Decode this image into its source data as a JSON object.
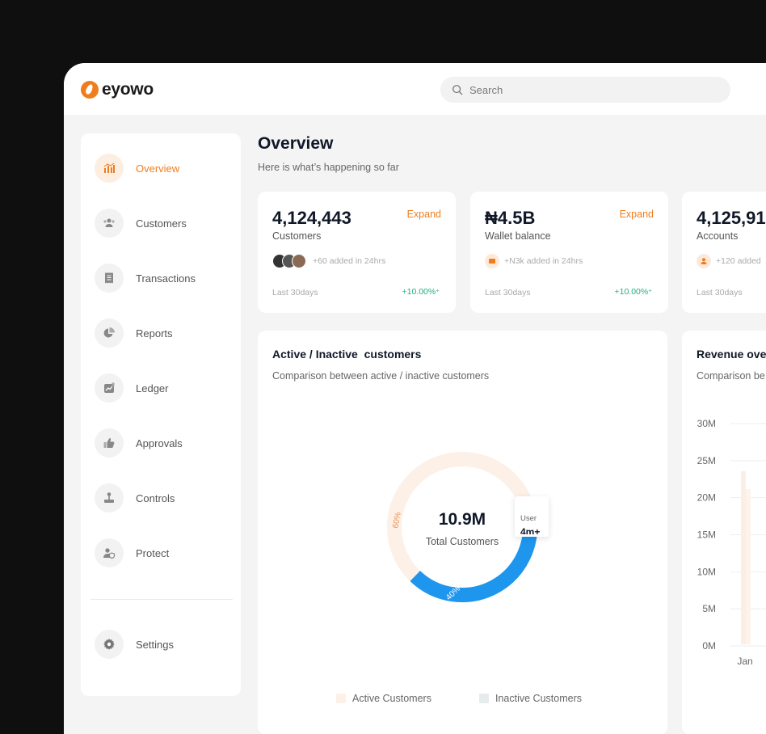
{
  "app": {
    "brand": "eyowo"
  },
  "search": {
    "placeholder": "Search"
  },
  "sidebar": {
    "items": [
      {
        "label": "Overview",
        "icon": "chart-bars-icon",
        "active": true
      },
      {
        "label": "Customers",
        "icon": "users-icon"
      },
      {
        "label": "Transactions",
        "icon": "receipt-icon"
      },
      {
        "label": "Reports",
        "icon": "pie-chart-icon"
      },
      {
        "label": "Ledger",
        "icon": "trend-icon"
      },
      {
        "label": "Approvals",
        "icon": "thumbs-up-icon"
      },
      {
        "label": "Controls",
        "icon": "joystick-icon"
      },
      {
        "label": "Protect",
        "icon": "user-shield-icon"
      }
    ],
    "settings": {
      "label": "Settings",
      "icon": "gear-icon"
    }
  },
  "header": {
    "title": "Overview",
    "subtitle": "Here is what’s happening so far"
  },
  "stats": [
    {
      "value": "4,124,443",
      "label": "Customers",
      "action": "Expand",
      "note": "+60 added in 24hrs",
      "period": "Last 30days",
      "trend": "+10.00%"
    },
    {
      "value": "₦4.5B",
      "label": "Wallet balance",
      "action": "Expand",
      "note": "+N3k added in 24hrs",
      "period": "Last 30days",
      "trend": "+10.00%"
    },
    {
      "value": "4,125,91",
      "label": "Accounts",
      "action": "",
      "note": "+120 added",
      "period": "Last 30days",
      "trend": ""
    }
  ],
  "active_chart": {
    "title": "Active / Inactive  customers",
    "subtitle": "Comparison between active / inactive customers",
    "center_value": "10.9M",
    "center_label": "Total Customers",
    "tooltip_label": "User",
    "tooltip_value": "4m+",
    "legend": [
      "Active Customers",
      "Inactive Customers"
    ],
    "colors": {
      "active": "#fdf0e6",
      "inactive": "#1e96ee"
    }
  },
  "chart_data": {
    "type": "pie",
    "categories": [
      "Active Customers",
      "Inactive Customers"
    ],
    "values": [
      60,
      40
    ],
    "labels": [
      "60%",
      "40%"
    ],
    "title": "Active / Inactive  customers"
  },
  "revenue": {
    "title": "Revenue ove",
    "subtitle": "Comparison be",
    "y_ticks": [
      "30M",
      "25M",
      "20M",
      "15M",
      "10M",
      "5M",
      "0M"
    ],
    "x_ticks": [
      "Jan"
    ]
  }
}
